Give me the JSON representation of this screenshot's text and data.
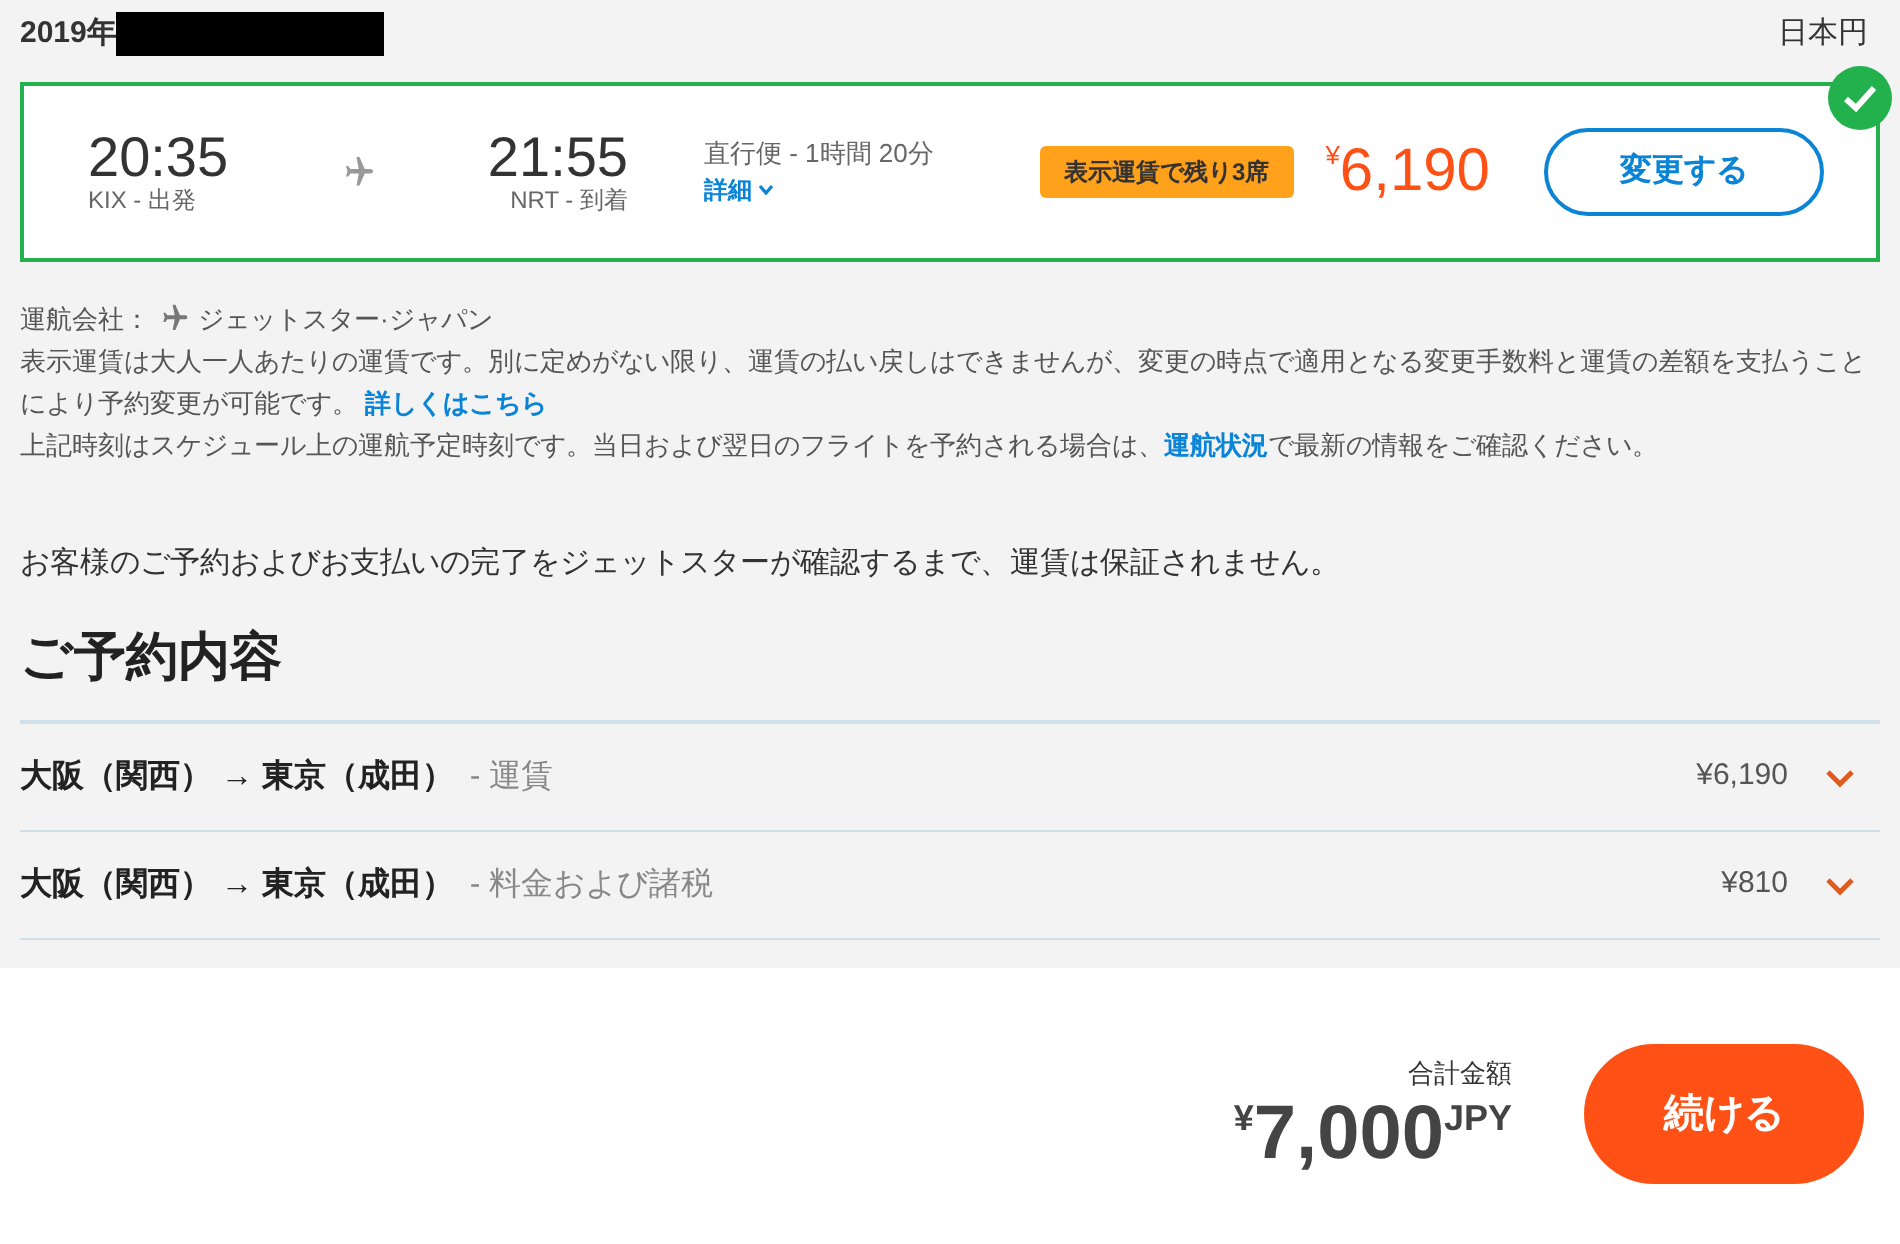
{
  "header": {
    "date_prefix": "2019年",
    "currency": "日本円"
  },
  "flight": {
    "selected": true,
    "depart_time": "20:35",
    "depart_label": "KIX - 出発",
    "arrive_time": "21:55",
    "arrive_label": "NRT - 到着",
    "summary": "直行便 - 1時間 20分",
    "details_link": "詳細",
    "badge": "表示運賃で残り3席",
    "price": {
      "currency": "¥",
      "amount": "6,190"
    },
    "change_button": "変更する"
  },
  "carrier": {
    "label": "運航会社：",
    "name": "ジェットスター·ジャパン"
  },
  "notes": [
    {
      "parts": [
        {
          "kind": "text",
          "text": "表示運賃は大人一人あたりの運賃です。別に定めがない限り、運賃の払い戻しはできませんが、変更の時点で適用となる変更手数料と運賃の差額を支払うことにより予約変更が可能です。 "
        },
        {
          "kind": "link",
          "text": "詳しくはこちら"
        }
      ]
    },
    {
      "parts": [
        {
          "kind": "text",
          "text": "上記時刻はスケジュール上の運航予定時刻です。当日および翌日のフライトを予約される場合は、"
        },
        {
          "kind": "link",
          "text": "運航状況"
        },
        {
          "kind": "text",
          "text": "で最新の情報をご確認ください。"
        }
      ]
    }
  ],
  "notice": "お客様のご予約およびお支払いの完了をジェットスターが確認するまで、運賃は保証されません。",
  "booking": {
    "title": "ご予約内容",
    "rows": [
      {
        "route": "大阪（関西） → 東京（成田）",
        "item": "- 運賃",
        "amount": "¥6,190",
        "expanded": false
      },
      {
        "route": "大阪（関西） → 東京（成田）",
        "item": "- 料金および諸税",
        "amount": "¥810",
        "expanded": false
      }
    ]
  },
  "total": {
    "label": "合計金額",
    "currency": "¥",
    "amount": "7,000",
    "unit": "JPY"
  },
  "continue_button": "続ける"
}
